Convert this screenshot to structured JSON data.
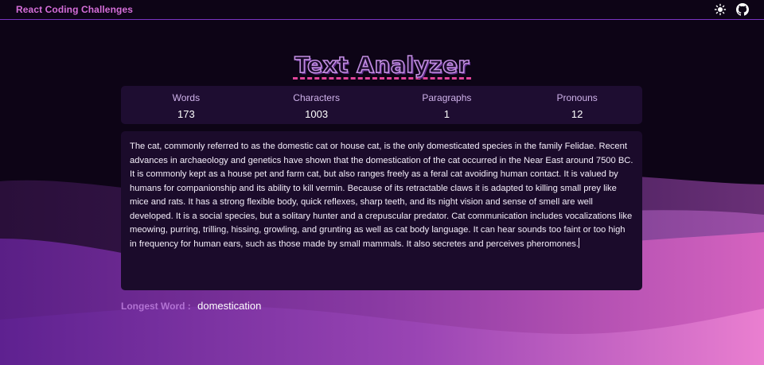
{
  "header": {
    "brand": "React Coding Challenges",
    "theme_toggle_icon": "sun-icon",
    "github_icon": "github-icon"
  },
  "title": "Text Analyzer",
  "stats": [
    {
      "label": "Words",
      "value": "173"
    },
    {
      "label": "Characters",
      "value": "1003"
    },
    {
      "label": "Paragraphs",
      "value": "1"
    },
    {
      "label": "Pronouns",
      "value": "12"
    }
  ],
  "text_input": {
    "value": "The cat, commonly referred to as the domestic cat or house cat, is the only domesticated species in the family Felidae. Recent advances in archaeology and genetics have shown that the domestication of the cat occurred in the Near East around 7500 BC. It is commonly kept as a house pet and farm cat, but also ranges freely as a feral cat avoiding human contact. It is valued by humans for companionship and its ability to kill vermin. Because of its retractable claws it is adapted to killing small prey like mice and rats. It has a strong flexible body, quick reflexes, sharp teeth, and its night vision and sense of smell are well developed. It is a social species, but a solitary hunter and a crepuscular predator. Cat communication includes vocalizations like meowing, purring, trilling, hissing, growling, and grunting as well as cat body language. It can hear sounds too faint or too high in frequency for human ears, such as those made by small mammals. It also secretes and perceives pheromones."
  },
  "longest_word": {
    "label": "Longest Word :",
    "value": "domestication"
  },
  "colors": {
    "brand": "#d56ed9",
    "accent_border": "#7a35c2",
    "title_underline": "#e0449a",
    "panel": "#1e0d31"
  }
}
